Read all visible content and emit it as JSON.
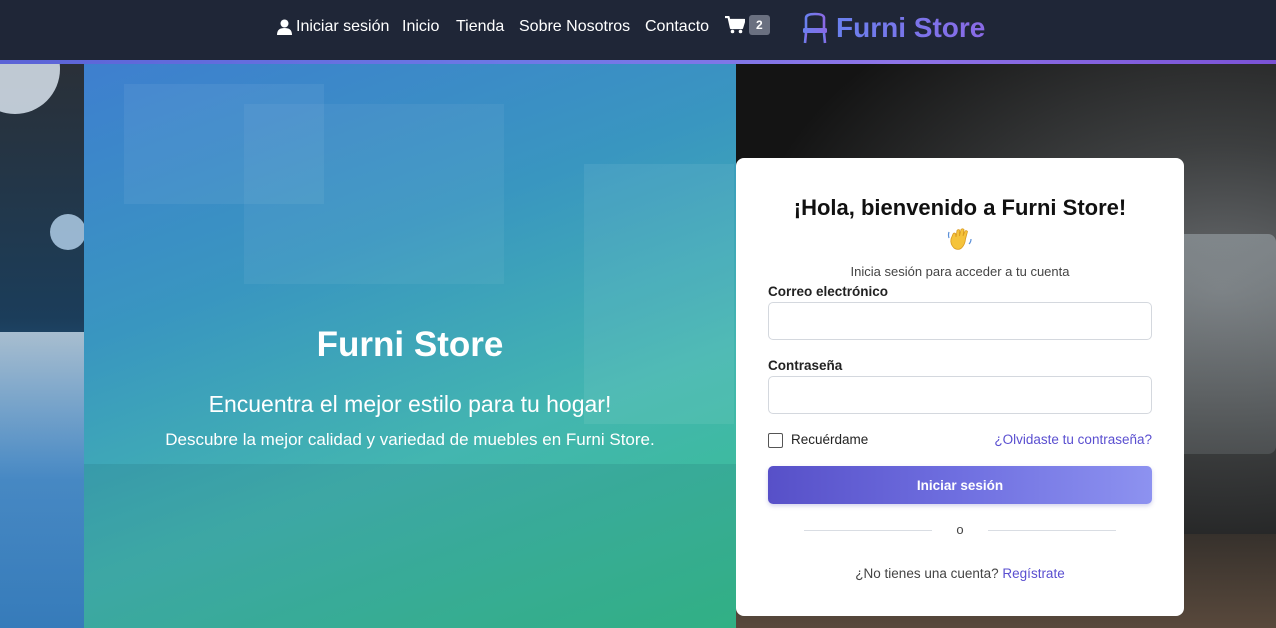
{
  "nav": {
    "login": "Iniciar sesión",
    "inicio": "Inicio",
    "tienda": "Tienda",
    "sobre": "Sobre Nosotros",
    "contacto": "Contacto",
    "cart_count": "2",
    "brand": "Furni Store",
    "icons": {
      "user": "user-icon",
      "cart": "cart-icon",
      "brand": "chair-icon"
    }
  },
  "hero": {
    "title": "Furni Store",
    "subtitle": "Encuentra el mejor estilo para tu hogar!",
    "description": "Descubre la mejor calidad y variedad de muebles en Furni Store."
  },
  "login_card": {
    "title": "¡Hola, bienvenido a Furni Store!",
    "emoji_icon": "waving-hand-icon",
    "subtitle": "Inicia sesión para acceder a tu cuenta",
    "email_label": "Correo electrónico",
    "email_value": "",
    "password_label": "Contraseña",
    "password_value": "",
    "remember_label": "Recuérdame",
    "forgot_link": "¿Olvidaste tu contraseña?",
    "submit_label": "Iniciar sesión",
    "divider_text": "o",
    "signup_prompt": "¿No tienes una cuenta?",
    "signup_link": "Regístrate"
  },
  "colors": {
    "navbar": "#1f2637",
    "accent": "#5a4fd0",
    "button_start": "#5750c8",
    "button_end": "#8d92f0",
    "hero_start": "#3e7fcf",
    "hero_end": "#36c08a"
  }
}
